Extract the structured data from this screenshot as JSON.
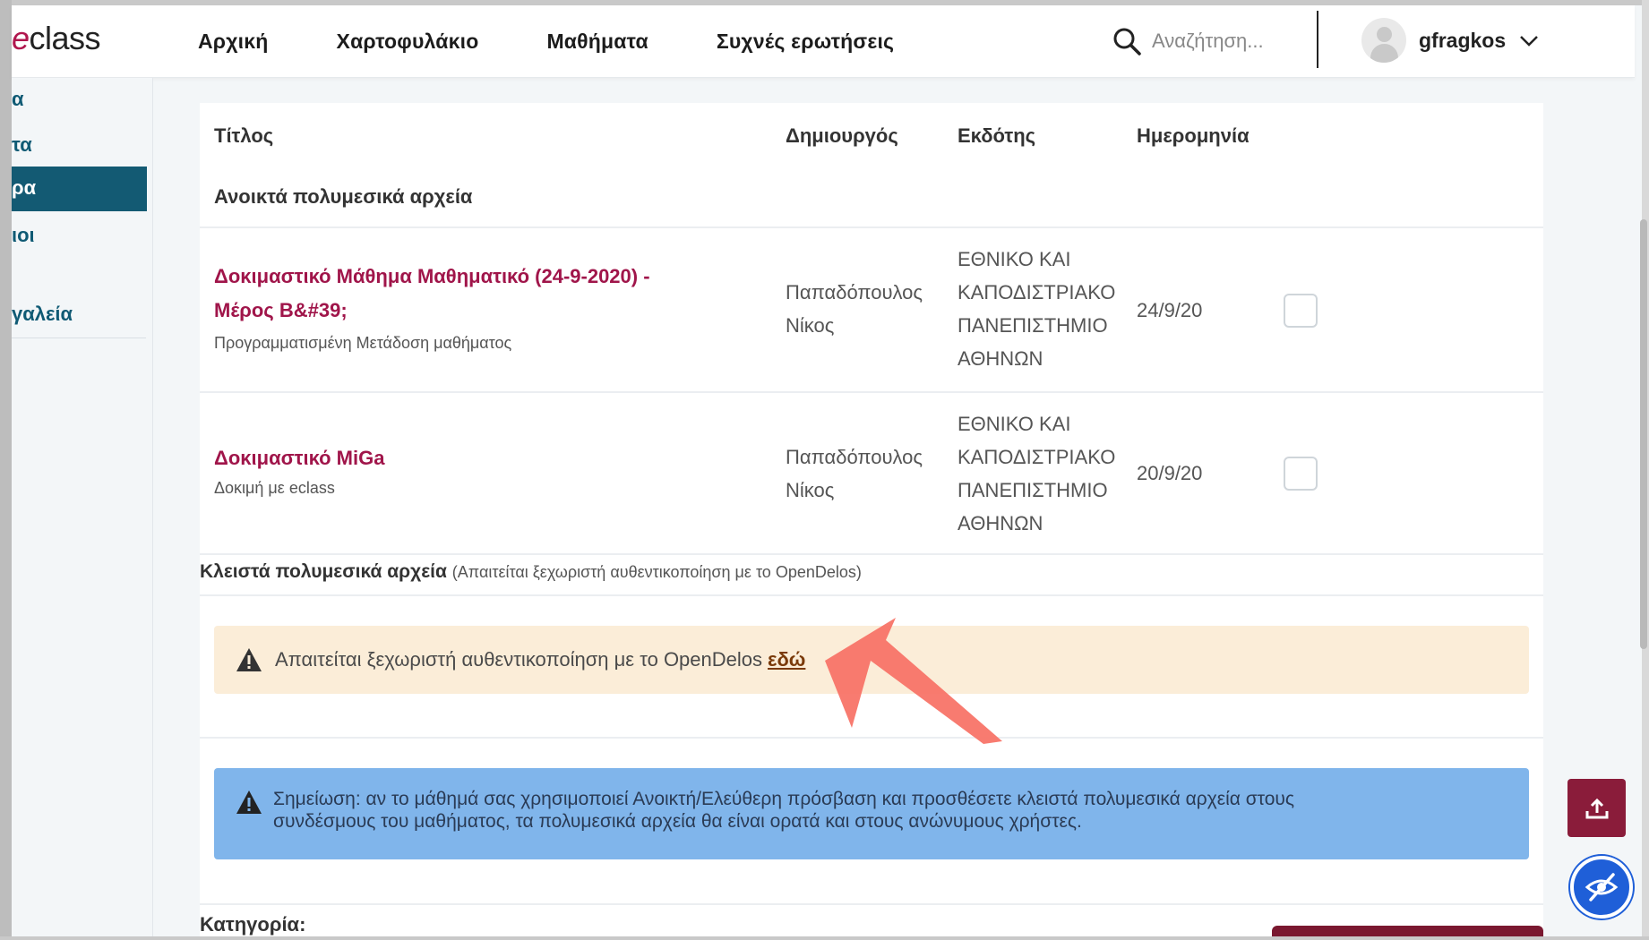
{
  "header": {
    "logo_prefix": "e",
    "logo_text": "class",
    "nav": [
      "Αρχική",
      "Χαρτοφυλάκιο",
      "Μαθήματα",
      "Συχνές ερωτήσεις"
    ],
    "search_placeholder": "Αναζήτηση...",
    "username": "gfragkos"
  },
  "sidebar": {
    "items": [
      "α",
      "τα",
      "ρα",
      "ιοι",
      "γαλεία"
    ],
    "active_index": 2
  },
  "table": {
    "headers": {
      "title": "Τίτλος",
      "creator": "Δημιουργός",
      "publisher": "Εκδότης",
      "date": "Ημερομηνία"
    },
    "open_section_title": "Ανοικτά πολυμεσικά αρχεία",
    "rows": [
      {
        "title_line1": "Δοκιμαστικό Μάθημα Μαθηματικό (24-9-2020) -",
        "title_line2": "Μέρος Β&#39;",
        "subtitle": "Προγραμματισμένη Μετάδοση μαθήματος",
        "creator_line1": "Παπαδόπουλος",
        "creator_line2": "Νίκος",
        "publisher_lines": [
          "ΕΘΝΙΚΟ ΚΑΙ",
          "ΚΑΠΟΔΙΣΤΡΙΑΚΟ",
          "ΠΑΝΕΠΙΣΤΗΜΙΟ",
          "ΑΘΗΝΩΝ"
        ],
        "date": "24/9/20"
      },
      {
        "title_line1": "Δοκιμαστικό MiGa",
        "subtitle": "Δοκιμή με eclass",
        "creator_line1": "Παπαδόπουλος",
        "creator_line2": "Νίκος",
        "publisher_lines": [
          "ΕΘΝΙΚΟ ΚΑΙ",
          "ΚΑΠΟΔΙΣΤΡΙΑΚΟ",
          "ΠΑΝΕΠΙΣΤΗΜΙΟ",
          "ΑΘΗΝΩΝ"
        ],
        "date": "20/9/20"
      }
    ]
  },
  "closed": {
    "title": "Κλειστά πολυμεσικά αρχεία",
    "note": "(Απαιτείται ξεχωριστή αυθεντικοποίηση με το OpenDelos)",
    "warning_text": "Απαιτείται ξεχωριστή αυθεντικοποίηση με το OpenDelos",
    "warning_link": "εδώ",
    "info_line1": "Σημείωση: αν το μάθημά σας χρησιμοποιεί Ανοικτή/Ελεύθερη πρόσβαση και προσθέσετε κλειστά πολυμεσικά αρχεία στους",
    "info_line2": "συνδέσμους του μαθήματος, τα πολυμεσικά αρχεία θα είναι ορατά και στους ανώνυμους χρήστες."
  },
  "category_label": "Κατηγορία:",
  "colors": {
    "accent": "#a0154a",
    "sidebar_active": "#135a73",
    "warning_bg": "#fbedd8",
    "info_bg": "#80b5eb",
    "annotation_arrow": "#f87468"
  },
  "icons": [
    "search-icon",
    "avatar-icon",
    "chevron-down-icon",
    "warning-icon",
    "upload-icon",
    "eye-off-icon"
  ]
}
